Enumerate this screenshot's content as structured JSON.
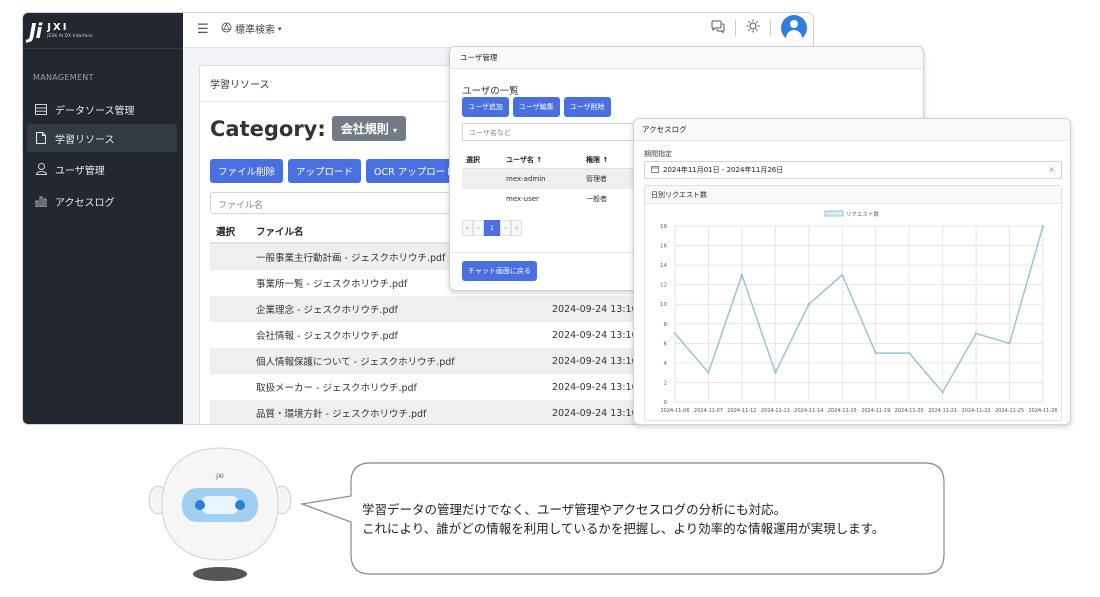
{
  "app": {
    "logo_mark": "Ji",
    "logo_name": "JXI",
    "logo_sub": "JESK AI DX Interface",
    "sidebar": {
      "section": "MANAGEMENT",
      "items": [
        {
          "label": "データソース管理",
          "icon": "table-icon",
          "active": false
        },
        {
          "label": "学習リソース",
          "icon": "document-icon",
          "active": true
        },
        {
          "label": "ユーザ管理",
          "icon": "user-icon",
          "active": false
        },
        {
          "label": "アクセスログ",
          "icon": "bar-chart-icon",
          "active": false
        }
      ]
    },
    "topbar": {
      "menu_icon": "hamburger-icon",
      "search_mode_label": "標準検索",
      "icons": [
        "chat-icon",
        "sun-icon",
        "user-avatar-icon"
      ]
    },
    "resources": {
      "card_title": "学習リソース",
      "category_label": "Category:",
      "category_value": "会社規則",
      "buttons": {
        "delete": "ファイル削除",
        "upload": "アップロード",
        "ocr_upload": "OCR アップロード"
      },
      "search_placeholder": "ファイル名",
      "columns": {
        "select": "選択",
        "name": "ファイル名"
      },
      "rows": [
        {
          "name": "一般事業主行動計画 - ジェスクホリウチ.pdf",
          "date": ""
        },
        {
          "name": "事業所一覧 - ジェスクホリウチ.pdf",
          "date": ""
        },
        {
          "name": "企業理念 - ジェスクホリウチ.pdf",
          "date": "2024-09-24 13:10"
        },
        {
          "name": "会社情報 - ジェスクホリウチ.pdf",
          "date": "2024-09-24 13:10"
        },
        {
          "name": "個人情報保護について - ジェスクホリウチ.pdf",
          "date": "2024-09-24 13:10"
        },
        {
          "name": "取扱メーカー - ジェスクホリウチ.pdf",
          "date": "2024-09-24 13:10"
        },
        {
          "name": "品質・環境方針 - ジェスクホリウチ.pdf",
          "date": "2024-09-24 13:10"
        }
      ]
    }
  },
  "user_panel": {
    "title": "ユーザ管理",
    "subtitle": "ユーザの一覧",
    "buttons": {
      "add": "ユーザ追加",
      "edit": "ユーザ編集",
      "delete": "ユーザ削除"
    },
    "search_placeholder": "ユーザ名など",
    "columns": {
      "select": "選択",
      "name": "ユーザ名 ↑",
      "role": "権限 ↑"
    },
    "rows": [
      {
        "name": "mex-admin",
        "role": "管理者"
      },
      {
        "name": "mex-user",
        "role": "一般者"
      }
    ],
    "pager": {
      "first": "«",
      "prev": "‹",
      "current": "1",
      "next": "›",
      "last": "»"
    },
    "back_button": "チャット画面に戻る"
  },
  "log_panel": {
    "title": "アクセスログ",
    "period_label": "期間指定",
    "period_value": "2024年11月01日 - 2024年11月26日",
    "clear": "×",
    "chart_title": "日別リクエスト数"
  },
  "chart_data": {
    "type": "line",
    "categories": [
      "2024-11-06",
      "2024-11-07",
      "2024-11-12",
      "2024-11-13",
      "2024-11-14",
      "2024-11-15",
      "2024-11-19",
      "2024-11-20",
      "2024-11-21",
      "2024-11-22",
      "2024-11-25",
      "2024-11-26"
    ],
    "series": [
      {
        "name": "リクエスト数",
        "values": [
          7,
          3,
          13,
          3,
          10,
          13,
          5,
          5,
          1,
          7,
          6,
          18
        ],
        "color": "#9cc3d5"
      }
    ],
    "ylim": [
      0,
      18
    ],
    "yticks": [
      0,
      2,
      4,
      6,
      8,
      10,
      12,
      14,
      16,
      18
    ],
    "grid": true,
    "legend": "top-center"
  },
  "bubble": {
    "line1": "学習データの管理だけでなく、ユーザ管理やアクセスログの分析にも対応。",
    "line2": "これにより、誰がどの情報を利用しているかを把握し、より効率的な情報運用が実現します。"
  },
  "robot": {
    "badge": "JXI"
  }
}
